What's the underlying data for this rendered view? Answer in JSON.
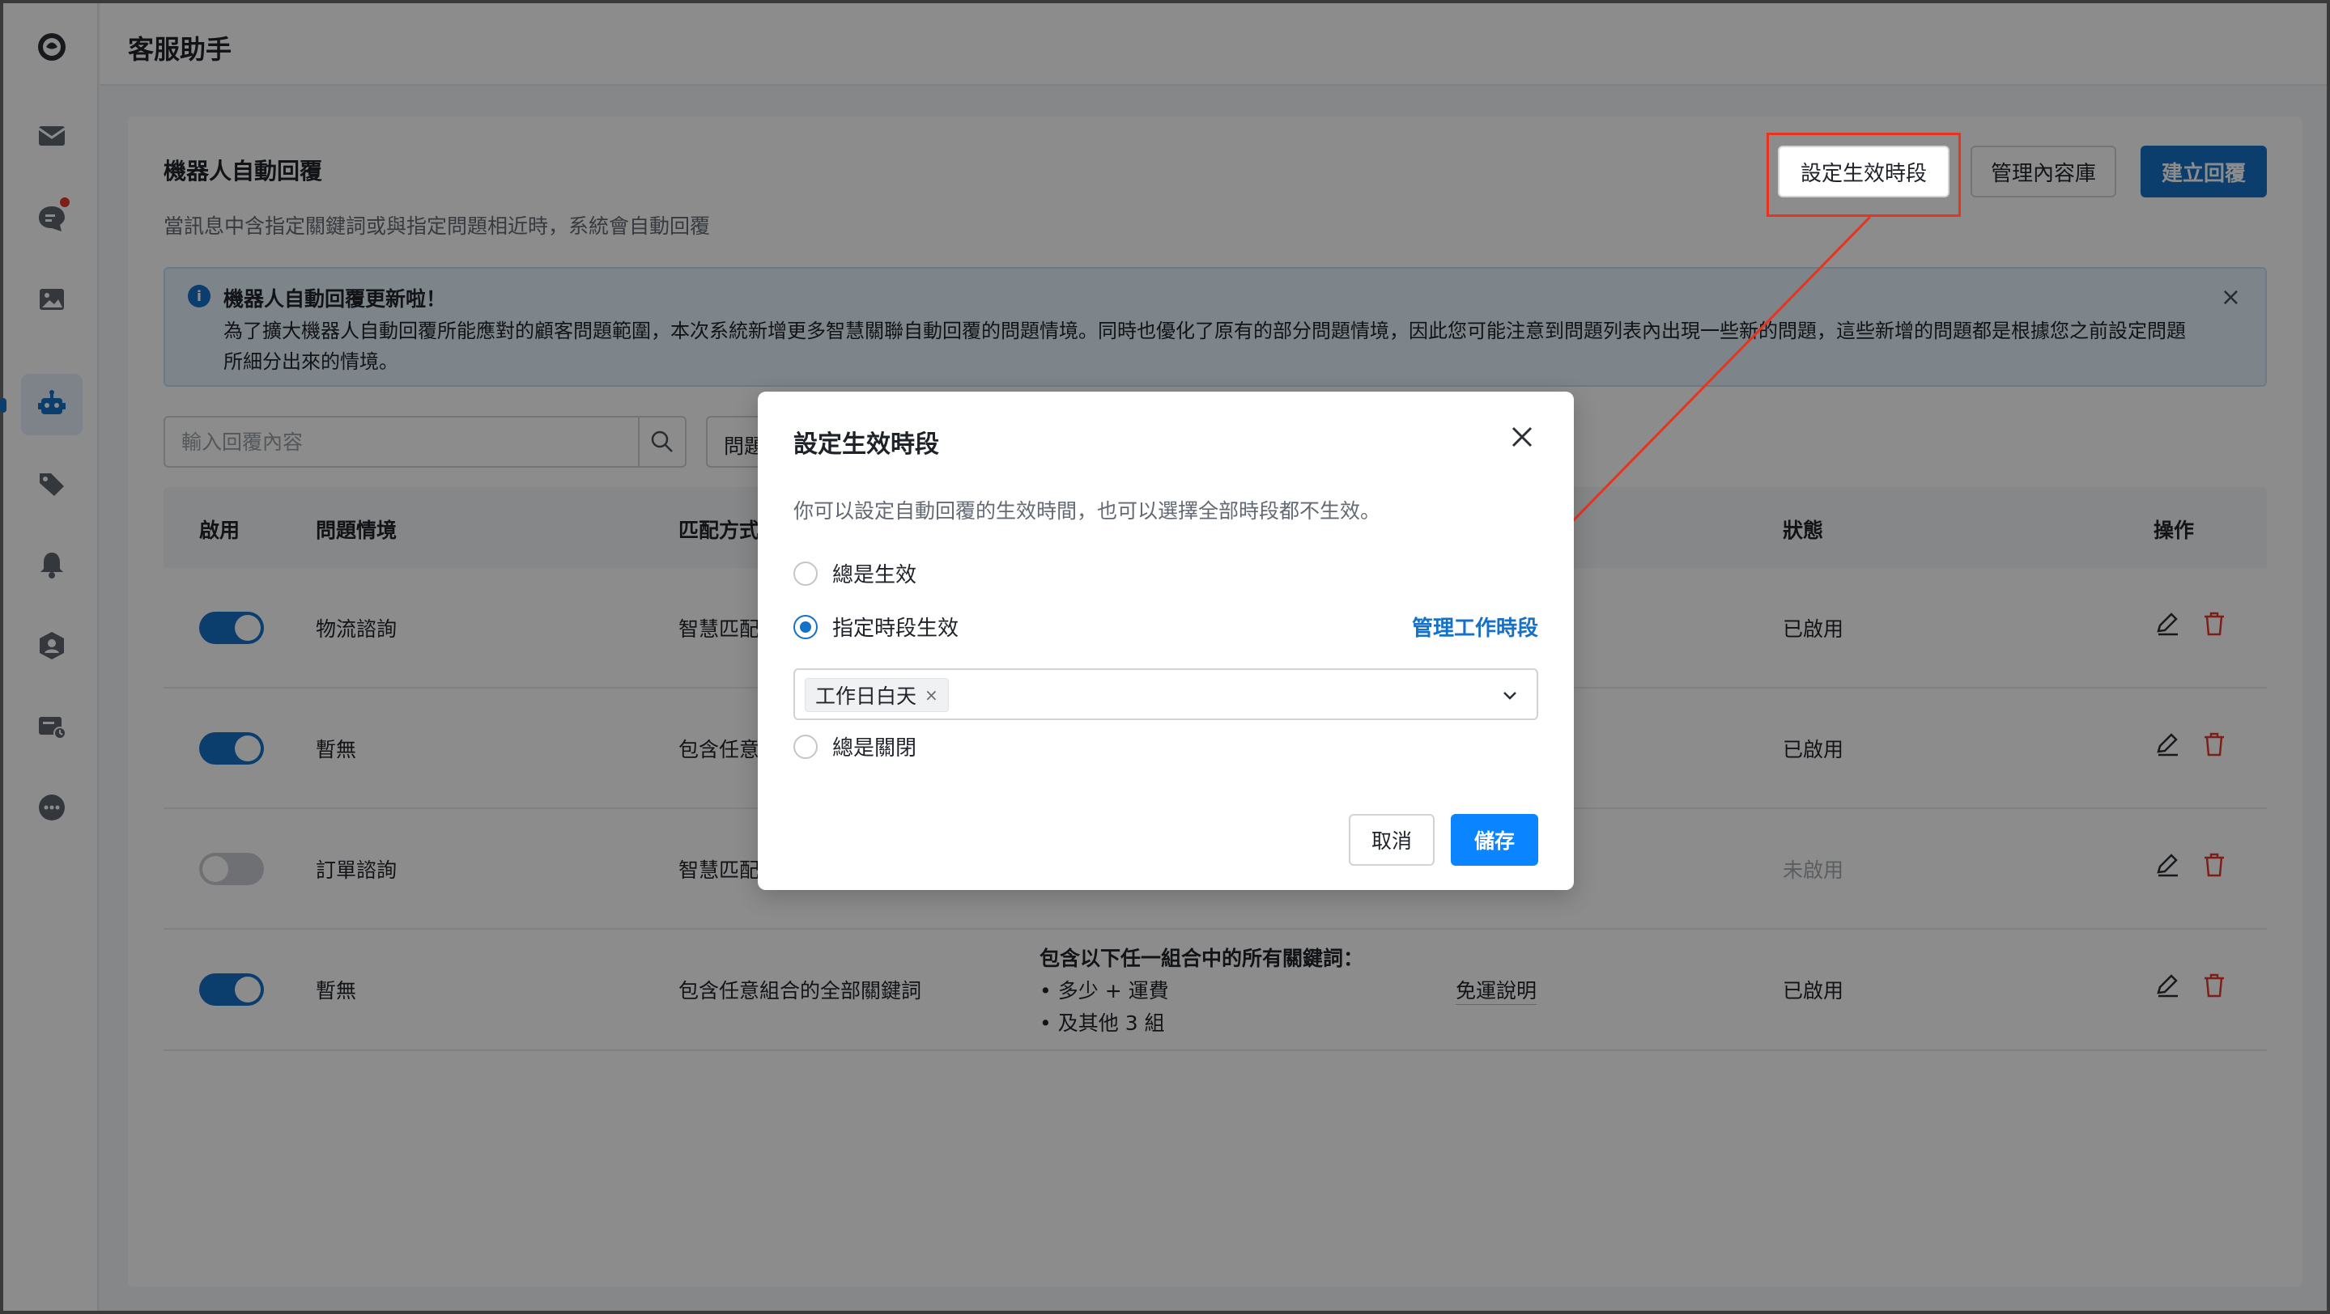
{
  "app": {
    "title": "客服助手"
  },
  "page": {
    "title": "機器人自動回覆",
    "description": "當訊息中含指定關鍵詞或與指定問題相近時，系統會自動回覆",
    "buttons": {
      "schedule": "設定生效時段",
      "library": "管理內容庫",
      "create": "建立回覆"
    }
  },
  "notice": {
    "title": "機器人自動回覆更新啦！",
    "body": "為了擴大機器人自動回覆所能應對的顧客問題範圍，本次系統新增更多智慧關聯自動回覆的問題情境。同時也優化了原有的部分問題情境，因此您可能注意到問題列表內出現一些新的問題，這些新增的問題都是根據您之前設定問題所細分出來的情境。"
  },
  "filters": {
    "search_placeholder": "輸入回覆內容",
    "question_filter": "問題"
  },
  "table": {
    "headers": {
      "enabled": "啟用",
      "scenario": "問題情境",
      "match": "匹配方式",
      "status": "狀態",
      "actions": "操作"
    },
    "rows": [
      {
        "enabled": true,
        "scenario": "物流諮詢",
        "match": "智慧匹配",
        "status": "已啟用"
      },
      {
        "enabled": true,
        "scenario": "暫無",
        "match": "包含任意",
        "status": "已啟用"
      },
      {
        "enabled": false,
        "scenario": "訂單諮詢",
        "match": "智慧匹配",
        "status": "未啟用"
      },
      {
        "enabled": true,
        "scenario": "暫無",
        "match": "包含任意組合的全部關鍵詞",
        "status": "已啟用",
        "condition": {
          "title": "包含以下任一組合中的所有關鍵詞：",
          "items": [
            "多少 + 運費",
            "及其他 3 組"
          ]
        },
        "reply": "免運說明"
      }
    ]
  },
  "modal": {
    "title": "設定生效時段",
    "description": "你可以設定自動回覆的生效時間，也可以選擇全部時段都不生效。",
    "options": {
      "always_on": "總是生效",
      "scheduled": "指定時段生效",
      "always_off": "總是關閉"
    },
    "selected_option": "scheduled",
    "manage_link": "管理工作時段",
    "selected_tag": "工作日白天",
    "cancel": "取消",
    "save": "儲存"
  },
  "colors": {
    "primary": "#1570c7",
    "danger": "#e5372d",
    "highlight": "#e7341f",
    "save": "#0a84ff"
  },
  "sidebar": {
    "icons": [
      "logo-icon",
      "mail-icon",
      "chat-icon",
      "image-icon",
      "robot-icon",
      "tag-icon",
      "bell-icon",
      "agent-icon",
      "ticket-icon",
      "more-icon"
    ],
    "active": "robot-icon"
  }
}
